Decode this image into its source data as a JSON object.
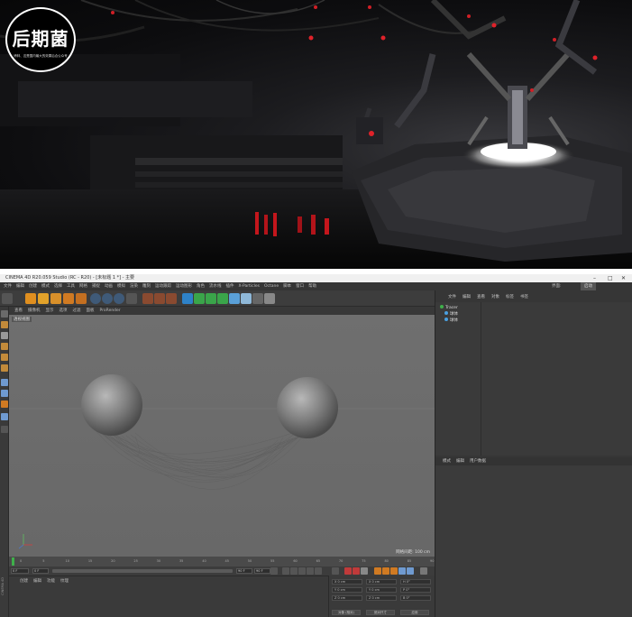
{
  "watermark": {
    "brand": "后期菌",
    "tagline": "缔林、这是国内最大的效果后合公众号"
  },
  "app": {
    "window_title": "CINEMA 4D R20.059 Studio (RC - R20) - [未标题 1 *] - 主要",
    "window_controls": {
      "minimize": "–",
      "maximize": "□",
      "close": "✕"
    },
    "menu": [
      "文件",
      "编辑",
      "创建",
      "模式",
      "选择",
      "工具",
      "网格",
      "捕捉",
      "动画",
      "模拟",
      "渲染",
      "雕刻",
      "运动跟踪",
      "运动图形",
      "角色",
      "流水线",
      "插件",
      "X-Particles",
      "Octane",
      "脚本",
      "窗口",
      "帮助"
    ],
    "layout_label": "界面:",
    "layout_value": "启动"
  },
  "viewport": {
    "menu": [
      "查看",
      "摄像机",
      "显示",
      "选项",
      "过滤",
      "面板",
      "ProRender"
    ],
    "view_label": "透视视图",
    "status": "网格间距: 100 cm"
  },
  "timeline": {
    "frames": [
      "0",
      "5",
      "10",
      "15",
      "20",
      "25",
      "30",
      "35",
      "40",
      "45",
      "50",
      "55",
      "60",
      "65",
      "70",
      "75",
      "80",
      "85",
      "90"
    ],
    "frame_display": "0 F",
    "start": "0 F",
    "end": "90 F",
    "end2": "90 F"
  },
  "material_panel": {
    "menu": [
      "创建",
      "编辑",
      "功能",
      "纹理"
    ]
  },
  "coord_panel": {
    "rows": [
      {
        "x": "X  0 cm",
        "xh": "X  0 cm",
        "h": "H  0°"
      },
      {
        "x": "Y  0 cm",
        "xh": "Y  0 cm",
        "h": "P  0°"
      },
      {
        "x": "Z  0 cm",
        "xh": "Z  0 cm",
        "h": "B  0°"
      }
    ],
    "btn_object": "对象 (相对)",
    "btn_size": "绝对尺寸",
    "btn_apply": "应用"
  },
  "object_manager": {
    "menu": [
      "文件",
      "编辑",
      "查看",
      "对象",
      "标签",
      "书签"
    ],
    "objects": [
      {
        "name": "Tracer",
        "indent": 0
      },
      {
        "name": "球体",
        "indent": 1
      },
      {
        "name": "球体",
        "indent": 1
      }
    ]
  },
  "attribute_manager": {
    "menu": [
      "模式",
      "编辑",
      "用户数据"
    ]
  },
  "sidebar_label": "CINEMA 4D"
}
